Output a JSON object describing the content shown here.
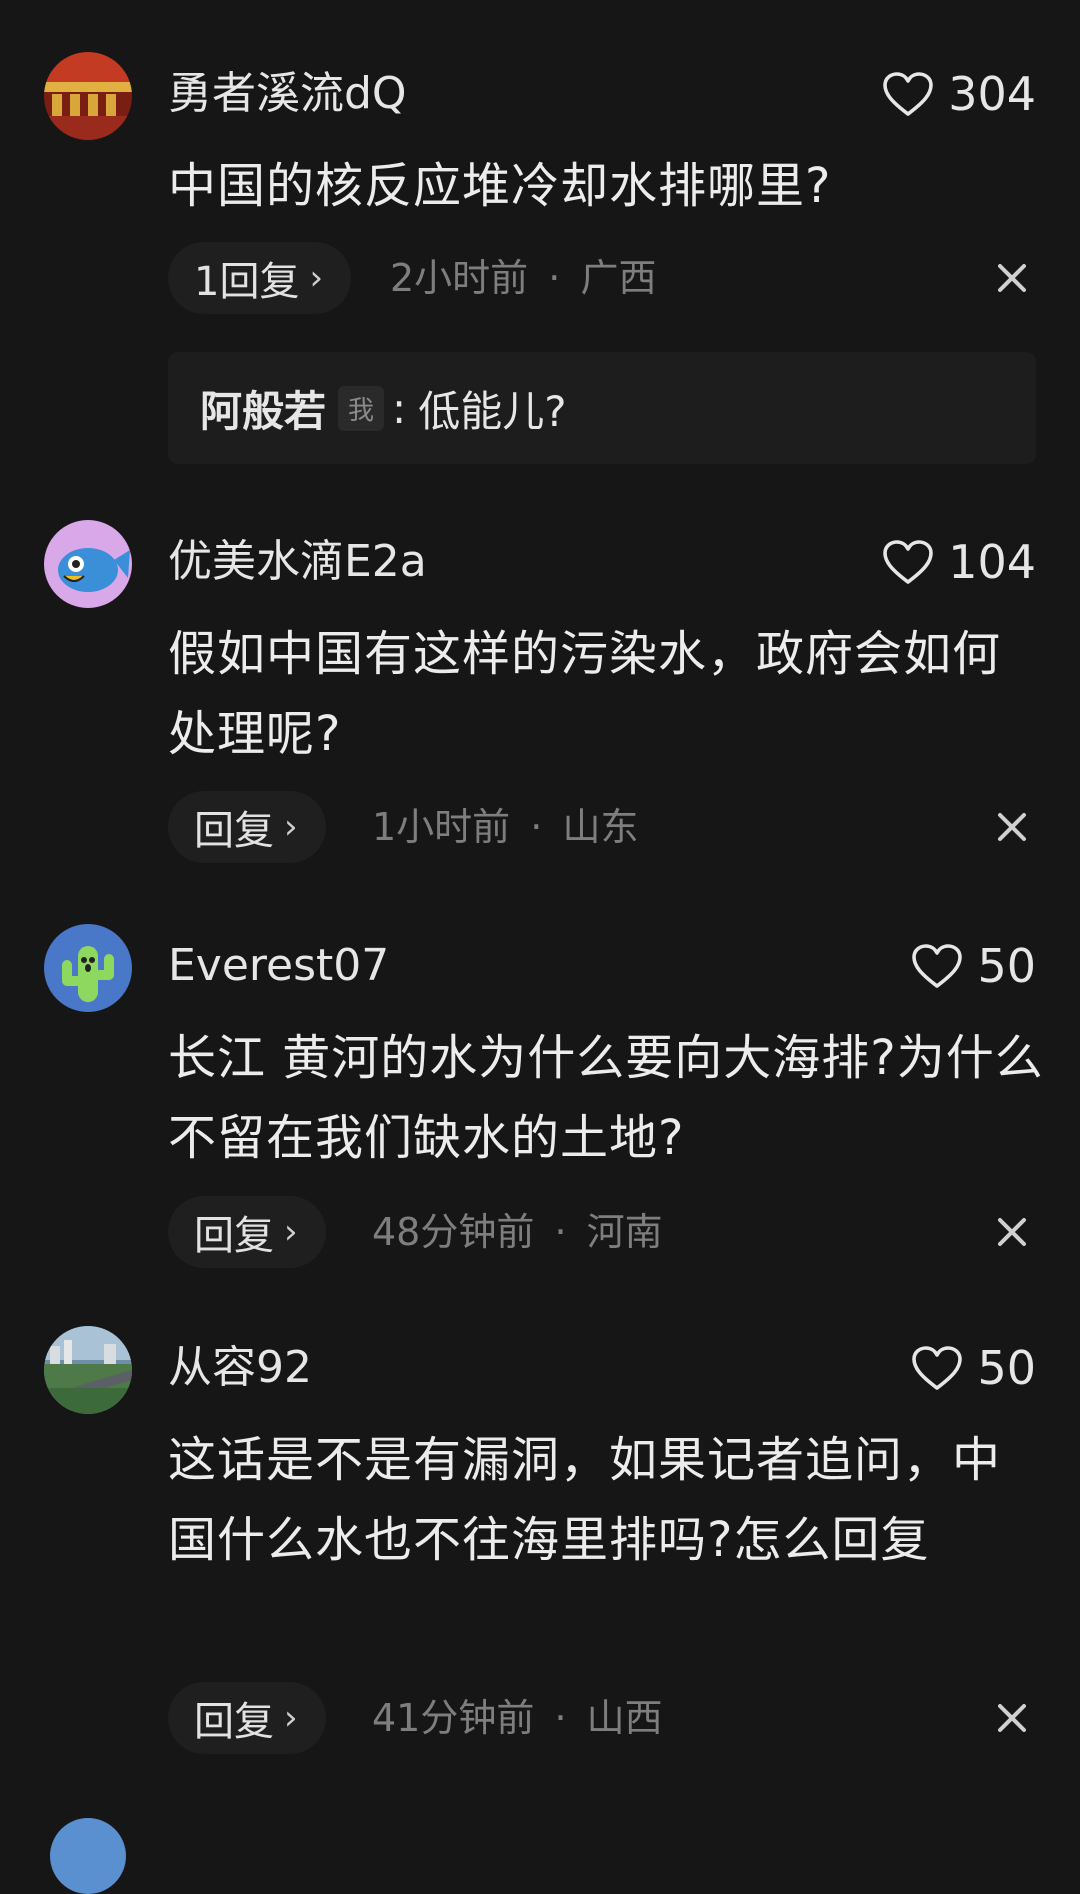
{
  "comments": [
    {
      "username": "勇者溪流dQ",
      "likes": "304",
      "text": "中国的核反应堆冷却水排哪里?",
      "reply_label": "1回复",
      "time": "2小时前",
      "location": "广西",
      "sub_reply": {
        "name": "阿般若",
        "badge": "我",
        "colon": ":",
        "text": "低能儿?"
      }
    },
    {
      "username": "优美水滴E2a",
      "likes": "104",
      "text": "假如中国有这样的污染水，政府会如何处理呢?",
      "reply_label": "回复",
      "time": "1小时前",
      "location": "山东"
    },
    {
      "username": "Everest07",
      "likes": "50",
      "text": "长江 黄河的水为什么要向大海排?为什么不留在我们缺水的土地?",
      "reply_label": "回复",
      "time": "48分钟前",
      "location": "河南"
    },
    {
      "username": "从容92",
      "likes": "50",
      "text": "这话是不是有漏洞，如果记者追问，中国什么水也不往海里排吗?怎么回复",
      "reply_label": "回复",
      "time": "41分钟前",
      "location": "山西"
    }
  ],
  "ui": {
    "chevron": "›",
    "meta_separator": "·",
    "heart_icon": "heart-outline-icon",
    "close_icon": "close-x-icon"
  },
  "colors": {
    "background": "#161616",
    "text": "#e8e8e8",
    "meta": "#7e7e7e",
    "pill": "#1f1f1f"
  }
}
